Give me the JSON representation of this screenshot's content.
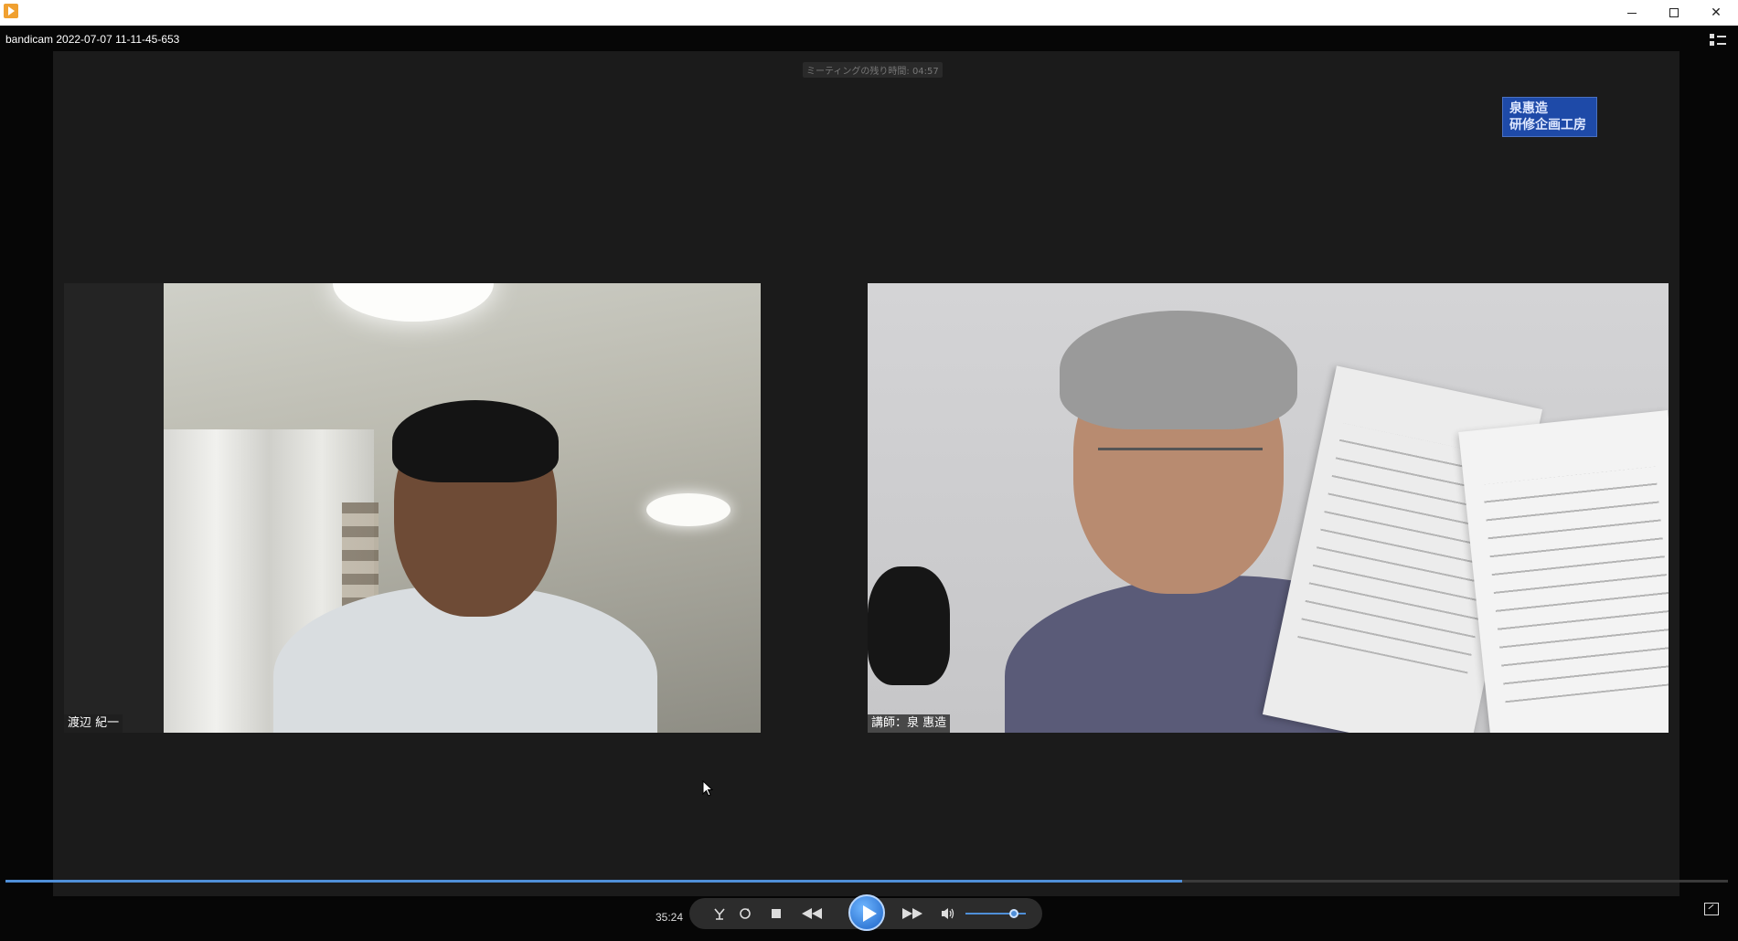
{
  "window": {
    "title_icon": "media-player-app-icon",
    "minimize_label": "minimize",
    "maximize_label": "maximize",
    "close_label": "close"
  },
  "player": {
    "file_title": "bandicam 2022-07-07 11-11-45-653",
    "current_time": "35:24",
    "progress_fraction": 0.683,
    "volume_fraction": 0.8,
    "accent_color": "#4f8fd8"
  },
  "video": {
    "meeting_timer": "ミーティングの残り時間: 04:57",
    "logo_line1": "泉惠造",
    "logo_line2": "研修企画工房",
    "participants": [
      {
        "name": "渡辺 紀一"
      },
      {
        "name": "講師：泉 惠造"
      }
    ]
  },
  "controls": {
    "icons": [
      "capture-icon",
      "repeat-icon",
      "stop-icon",
      "rewind-icon",
      "play-icon",
      "fast-forward-icon",
      "volume-icon",
      "playlist-toggle-icon",
      "pip-icon"
    ]
  }
}
